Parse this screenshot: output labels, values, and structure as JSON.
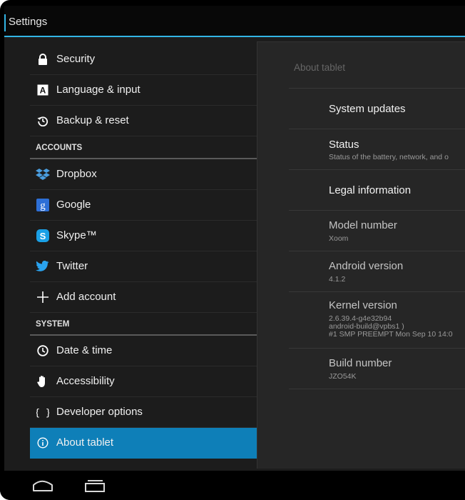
{
  "title_bar": {
    "title": "Settings"
  },
  "left_list": {
    "rows_top": [
      {
        "label": "Security",
        "icon": "lock-icon"
      },
      {
        "label": "Language & input",
        "icon": "keyboard-a-icon"
      },
      {
        "label": "Backup & reset",
        "icon": "backup-icon"
      }
    ],
    "accounts_header": "ACCOUNTS",
    "accounts": [
      {
        "label": "Dropbox",
        "icon": "dropbox-icon"
      },
      {
        "label": "Google",
        "icon": "google-icon"
      },
      {
        "label": "Skype™",
        "icon": "skype-icon"
      },
      {
        "label": "Twitter",
        "icon": "twitter-icon"
      },
      {
        "label": "Add account",
        "icon": "plus-icon"
      }
    ],
    "system_header": "SYSTEM",
    "system": [
      {
        "label": "Date & time",
        "icon": "clock-icon"
      },
      {
        "label": "Accessibility",
        "icon": "hand-icon"
      },
      {
        "label": "Developer options",
        "icon": "braces-icon"
      },
      {
        "label": "About tablet",
        "icon": "info-icon",
        "selected": true
      }
    ]
  },
  "detail": {
    "title": "About tablet",
    "items": [
      {
        "title": "System updates"
      },
      {
        "title": "Status",
        "summary": "Status of the battery, network, and o"
      },
      {
        "title": "Legal information"
      },
      {
        "title": "Model number",
        "summary": "Xoom"
      },
      {
        "title": "Android version",
        "summary": "4.1.2"
      },
      {
        "title": "Kernel version",
        "summary_lines": [
          "2.6.39.4-g4e32b94",
          "android-build@vpbs1 )",
          "#1 SMP PREEMPT Mon Sep 10 14:0"
        ]
      },
      {
        "title": "Build number",
        "summary": "JZO54K"
      }
    ]
  },
  "colors": {
    "accent": "#33b5e5",
    "selected_row": "#0e7fb8"
  }
}
